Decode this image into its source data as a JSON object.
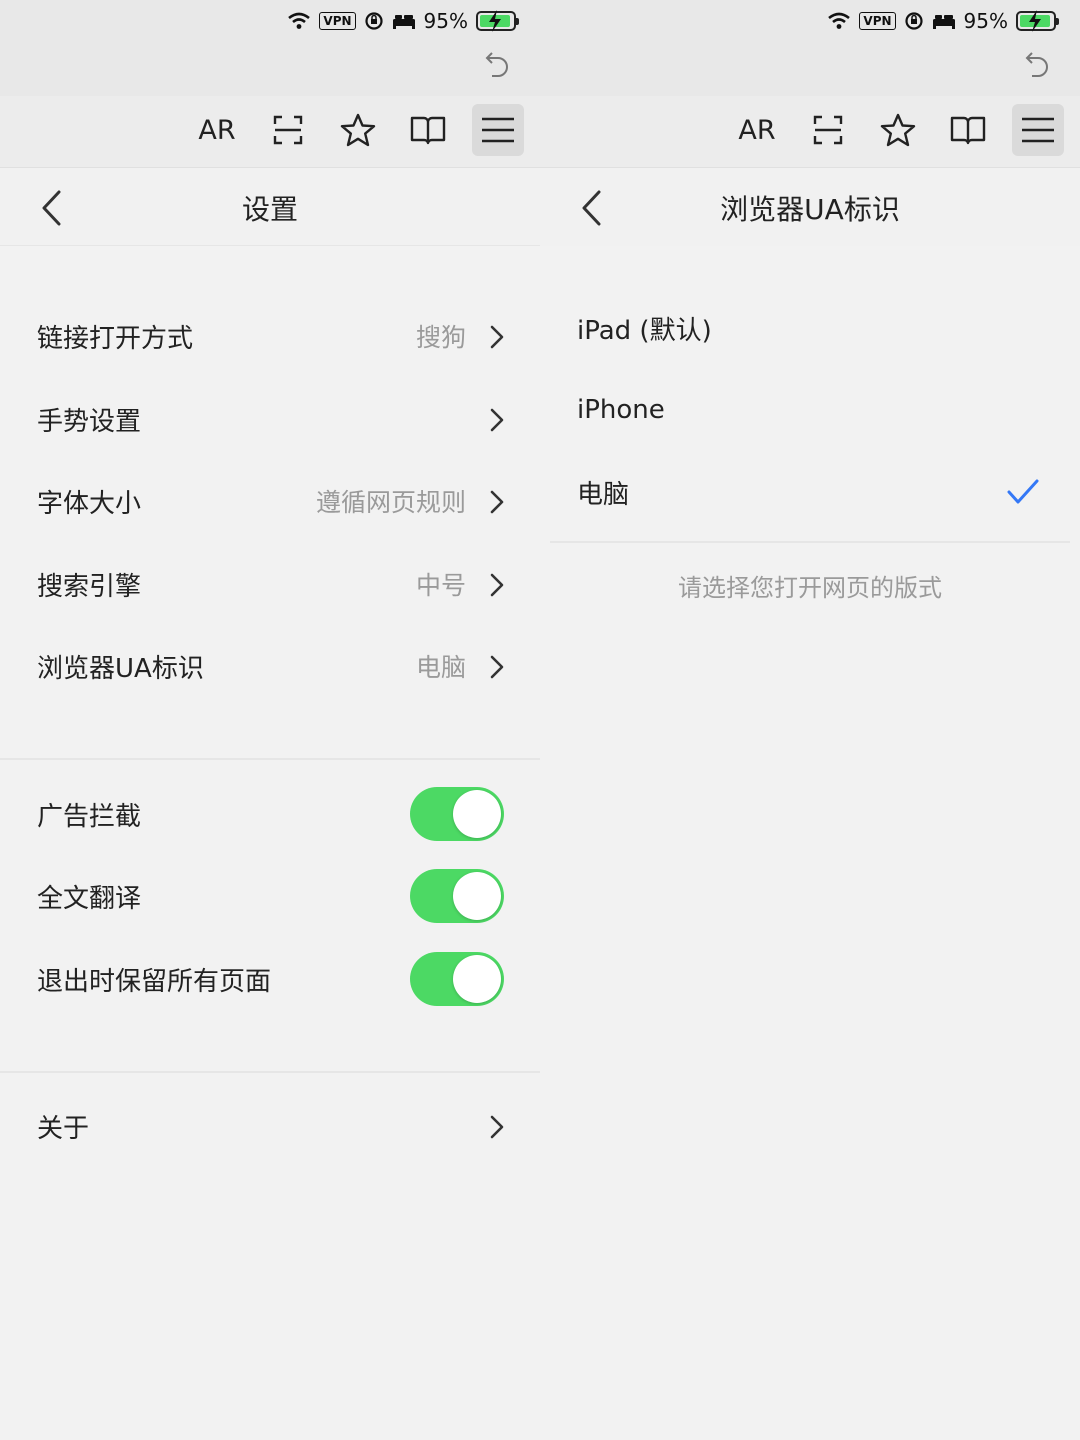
{
  "status": {
    "vpn_label": "VPN",
    "battery_text": "95%",
    "icons": [
      "wifi-icon",
      "vpn-badge",
      "rotation-lock-icon",
      "bed-icon",
      "battery-charging-icon"
    ],
    "battery_level_percent": 95
  },
  "toolbar": {
    "ar_label": "AR",
    "icons": [
      "scan-icon",
      "star-icon",
      "book-icon",
      "menu-icon"
    ],
    "undo_icon": "undo-icon"
  },
  "left": {
    "nav_title": "设置",
    "rows": [
      {
        "label": "链接打开方式",
        "value": "搜狗"
      },
      {
        "label": "手势设置",
        "value": ""
      },
      {
        "label": "字体大小",
        "value": "遵循网页规则"
      },
      {
        "label": "搜索引擎",
        "value": "中号"
      },
      {
        "label": "浏览器UA标识",
        "value": "电脑"
      }
    ],
    "toggles": [
      {
        "label": "广告拦截",
        "on": true
      },
      {
        "label": "全文翻译",
        "on": true
      },
      {
        "label": "退出时保留所有页面",
        "on": true
      }
    ],
    "about_label": "关于"
  },
  "right": {
    "nav_title": "浏览器UA标识",
    "options": [
      {
        "label": "iPad (默认)",
        "selected": false
      },
      {
        "label": "iPhone",
        "selected": false
      },
      {
        "label": "电脑",
        "selected": true
      }
    ],
    "hint": "请选择您打开网页的版式"
  },
  "colors": {
    "toggle_on": "#4cd964",
    "check": "#3478f6",
    "secondary_text": "#9a9a9a"
  }
}
